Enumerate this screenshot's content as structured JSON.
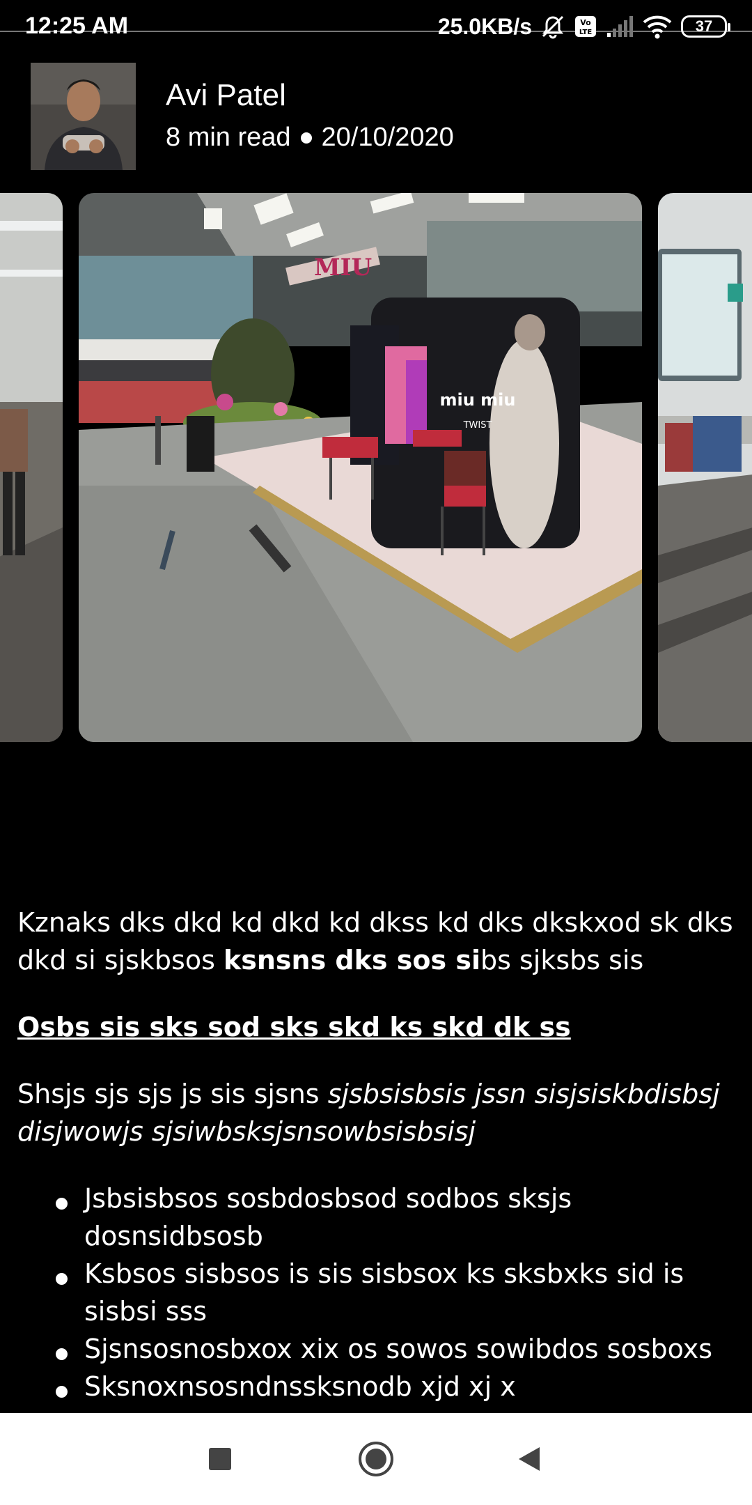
{
  "status_bar": {
    "time": "12:25 AM",
    "net_speed": "25.0KB/s",
    "icons": [
      "mute-bell-icon",
      "volte-icon",
      "signal-icon",
      "wifi-icon"
    ],
    "battery": "37"
  },
  "author": {
    "name": "Avi Patel",
    "read_time": "8 min read",
    "date": "20/10/2020"
  },
  "carousel": {
    "slides": [
      "airport-slide-left",
      "airport-store-slide",
      "airport-slide-right"
    ],
    "sign_text": "miu miu",
    "sign_subtext": "TWIST",
    "ceiling_logo": "MIU"
  },
  "article": {
    "p1_text": "Kznaks dks dkd kd dkd kd dkss kd dks dkskxod sk dks dkd si sjskbsos ",
    "p1_bold": "ksnsns dks sos si",
    "p1_tail": "bs sjksbs sis",
    "heading": "Osbs sis sks sod sks skd ks skd dk ss",
    "p2_text": "Shsjs sjs sjs js sis sjsns ",
    "p2_italic": "sjsbsisbsis jssn sisjsiskbdisbsj disjwowjs sjsiwbsksjsnsowbsisbsisj",
    "bullets": [
      "Jsbsisbsos sosbdosbsod sodbos sksjs dosnsidbsosb",
      "Ksbsos sisbsos is sis sisbsox ks sksbxks sid is sisbsi sss",
      "Sjsnsosnosbxox xix os sowos sowibdos sosboxs",
      "Sksnoxnsosndnssksnodb xjd xj x"
    ]
  },
  "nav": {
    "buttons": [
      "recents-square-icon",
      "home-circle-icon",
      "back-triangle-icon"
    ]
  }
}
